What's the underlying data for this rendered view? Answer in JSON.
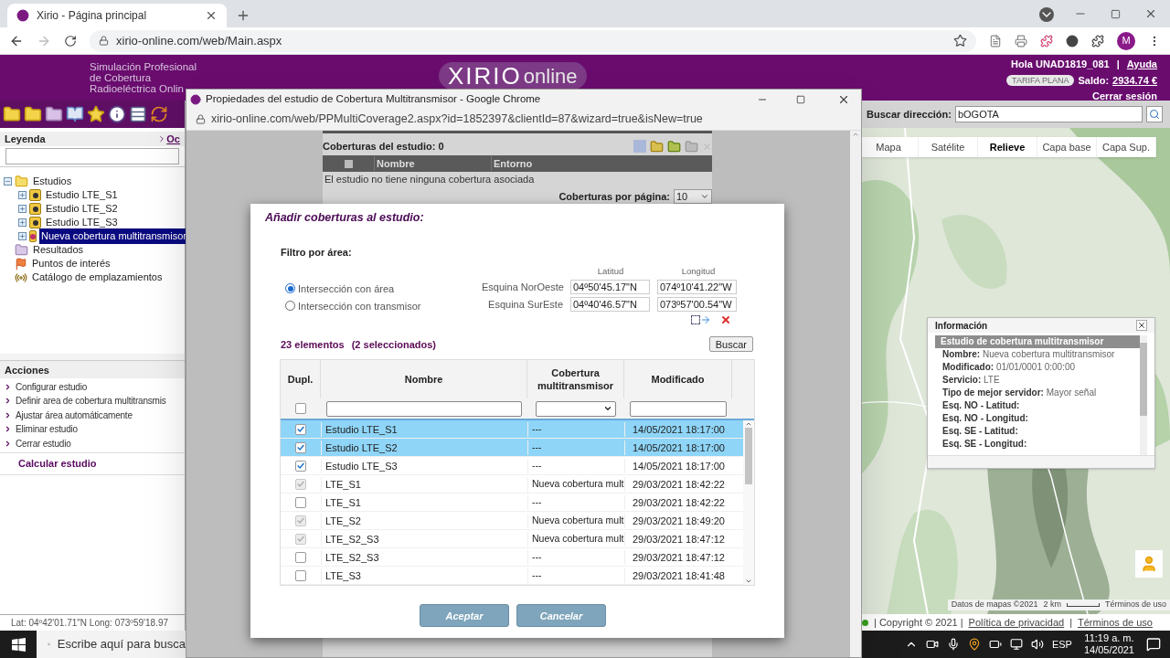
{
  "browser": {
    "tab_title": "Xirio - Página principal",
    "url": "xirio-online.com/web/Main.aspx",
    "profile_initial": "M"
  },
  "header": {
    "tagline": [
      "Simulación Profesional",
      "de Cobertura",
      "Radioeléctrica Onlin"
    ],
    "logo": "XIRIO",
    "logo_sub": "online",
    "greeting": "Hola UNAD1819_081",
    "separator": "|",
    "help": "Ayuda",
    "plan": "TARIFA PLANA",
    "balance_label": "Saldo:",
    "balance": "2934.74 €",
    "logout": "Cerrar sesión"
  },
  "legend": {
    "title": "Leyenda",
    "link": "Oc",
    "tree": [
      {
        "label": "Estudios",
        "kind": "folder",
        "expanded": true,
        "selected": false,
        "children": [
          {
            "label": "Estudio LTE_S1",
            "kind": "study",
            "expanded": false,
            "selected": false
          },
          {
            "label": "Estudio LTE_S2",
            "kind": "study",
            "expanded": false,
            "selected": false
          },
          {
            "label": "Estudio LTE_S3",
            "kind": "study",
            "expanded": false,
            "selected": false
          },
          {
            "label": "Nueva cobertura multitransmisor",
            "kind": "multi",
            "expanded": false,
            "selected": true
          }
        ]
      },
      {
        "label": "Resultados",
        "kind": "results",
        "selected": false
      },
      {
        "label": "Puntos de interés",
        "kind": "poi",
        "selected": false
      },
      {
        "label": "Catálogo de emplazamientos",
        "kind": "catalog",
        "selected": false
      }
    ]
  },
  "actions": {
    "title": "Acciones",
    "items": [
      "Configurar estudio",
      "Definir area de cobertura multitransmis",
      "Ajustar área automáticamente",
      "Eliminar estudio",
      "Cerrar estudio"
    ],
    "primary": "Calcular estudio"
  },
  "coords": "Lat: 04º42'01.71\"N Long: 073º59'18.97",
  "map": {
    "search_label": "Buscar dirección:",
    "search_value": "bOGOTA",
    "tabs": [
      {
        "label": "Mapa",
        "selected": false
      },
      {
        "label": "Satélite",
        "selected": false
      },
      {
        "label": "Relieve",
        "selected": true
      },
      {
        "label": "Capa base",
        "selected": false
      },
      {
        "label": "Capa Sup.",
        "selected": false
      }
    ],
    "attribution": "Datos de mapas ©2021",
    "scale": "2 km",
    "terms": "Términos de uso"
  },
  "info": {
    "title": "Información",
    "heading": "Estudio de cobertura multitransmisor",
    "items": [
      {
        "label": "Nombre:",
        "value": "Nueva cobertura multitransmisor"
      },
      {
        "label": "Modificado:",
        "value": "01/01/0001 0:00:00"
      },
      {
        "label": "Servicio:",
        "value": "LTE"
      },
      {
        "label": "Tipo de mejor servidor:",
        "value": "Mayor señal"
      },
      {
        "label": "Esq. NO - Latitud:"
      },
      {
        "label": "Esq. NO - Longitud:"
      },
      {
        "label": "Esq. SE - Latitud:"
      },
      {
        "label": "Esq. SE - Longitud:"
      }
    ]
  },
  "footer": {
    "copyright": "| Copyright © 2021 |",
    "privacy": "Política de privacidad",
    "separator": "|",
    "terms": "Términos de uso"
  },
  "popup": {
    "title": "Propiedades del estudio de Cobertura Multitransmisor - Google Chrome",
    "url": "xirio-online.com/web/PPMultiCoverage2.aspx?id=1852397&clientId=87&wizard=true&isNew=true",
    "count_label": "Coberturas del estudio: 0",
    "columns": [
      "Nombre",
      "Entorno"
    ],
    "empty": "El estudio no tiene ninguna cobertura asociada",
    "all_checked": false,
    "per_page_label": "Coberturas por página:",
    "per_page": "10"
  },
  "dialog": {
    "title": "Añadir coberturas al estudio:",
    "filter_label": "Filtro por área:",
    "options": [
      {
        "label": "Intersección con área",
        "selected": true
      },
      {
        "label": "Intersección con transmisor",
        "selected": false
      }
    ],
    "lat_label": "Latitud",
    "lon_label": "Longitud",
    "corners": [
      {
        "label": "Esquina NorOeste",
        "lat": "04º50'45.17\"N",
        "lon": "074º10'41.22\"W"
      },
      {
        "label": "Esquina SurEste",
        "lat": "04º40'46.57\"N",
        "lon": "073º57'00.54\"W"
      }
    ],
    "count": "23 elementos",
    "selected_count": "(2 seleccionados)",
    "search_button": "Buscar",
    "columns": [
      "Dupl.",
      "Nombre",
      "Cobertura multitransmisor",
      "Modificado"
    ],
    "all_checked": false,
    "rows": [
      {
        "checked": true,
        "disabled": false,
        "selected": true,
        "name": "Estudio LTE_S1",
        "coverage": "---",
        "modified": "14/05/2021 18:17:00"
      },
      {
        "checked": true,
        "disabled": false,
        "selected": true,
        "name": "Estudio LTE_S2",
        "coverage": "---",
        "modified": "14/05/2021 18:17:00"
      },
      {
        "checked": true,
        "disabled": false,
        "selected": false,
        "name": "Estudio LTE_S3",
        "coverage": "---",
        "modified": "14/05/2021 18:17:00"
      },
      {
        "checked": true,
        "disabled": true,
        "selected": false,
        "name": "LTE_S1",
        "coverage": "Nueva cobertura mult",
        "modified": "29/03/2021 18:42:22"
      },
      {
        "checked": false,
        "disabled": false,
        "selected": false,
        "name": "LTE_S1",
        "coverage": "---",
        "modified": "29/03/2021 18:42:22"
      },
      {
        "checked": true,
        "disabled": true,
        "selected": false,
        "name": "LTE_S2",
        "coverage": "Nueva cobertura mult",
        "modified": "29/03/2021 18:49:20"
      },
      {
        "checked": true,
        "disabled": true,
        "selected": false,
        "name": "LTE_S2_S3",
        "coverage": "Nueva cobertura mult",
        "modified": "29/03/2021 18:47:12"
      },
      {
        "checked": false,
        "disabled": false,
        "selected": false,
        "name": "LTE_S2_S3",
        "coverage": "---",
        "modified": "29/03/2021 18:47:12"
      },
      {
        "checked": false,
        "disabled": false,
        "selected": false,
        "name": "LTE_S3",
        "coverage": "---",
        "modified": "29/03/2021 18:41:48"
      }
    ],
    "accept": "Aceptar",
    "cancel": "Cancelar"
  },
  "taskbar": {
    "search": "Escribe aquí para busca",
    "lang": "ESP",
    "time": "11:19 a. m.",
    "date": "14/05/2021"
  }
}
